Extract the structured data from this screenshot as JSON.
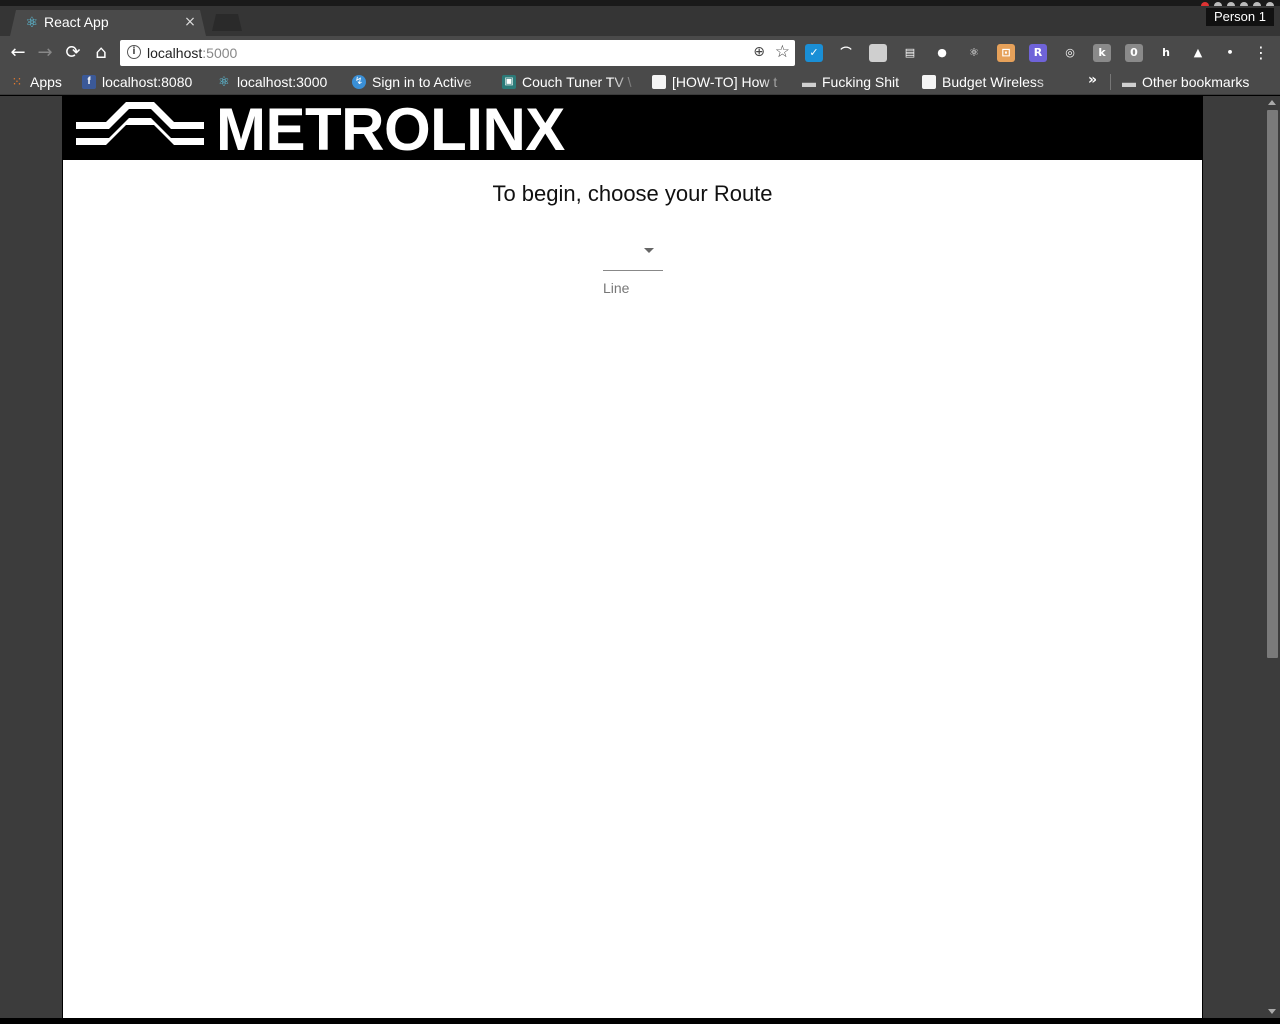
{
  "browser": {
    "tab": {
      "title": "React App",
      "favicon": "react-icon",
      "close": "×"
    },
    "profile": "Person 1",
    "omnibox": {
      "host": "localhost",
      "port": ":5000"
    },
    "nav": {
      "back": "←",
      "forward": "→",
      "reload": "⟳",
      "home": "⌂",
      "menu": "⋮"
    },
    "extensions": [
      {
        "name": "check-extension-icon",
        "glyph": "✓",
        "color": "#1a8fd6"
      },
      {
        "name": "rainbow-extension-icon",
        "glyph": "⌒",
        "color": "#4a4a4a"
      },
      {
        "name": "file-extension-icon",
        "glyph": "",
        "color": "#cfcfcf"
      },
      {
        "name": "chat-extension-icon",
        "glyph": "▤",
        "color": "#4a4a4a"
      },
      {
        "name": "circle-extension-icon",
        "glyph": "●",
        "color": "#4a4a4a"
      },
      {
        "name": "react-devtools-icon",
        "glyph": "⚛",
        "color": "#4a4a4a"
      },
      {
        "name": "outlet-extension-icon",
        "glyph": "⊡",
        "color": "#e6a15a"
      },
      {
        "name": "shield-extension-icon",
        "glyph": "R",
        "color": "#6f63d9"
      },
      {
        "name": "target-extension-icon",
        "glyph": "◎",
        "color": "#4a4a4a"
      },
      {
        "name": "k-extension-icon",
        "glyph": "k",
        "color": "#8a8a8a"
      },
      {
        "name": "box-extension-icon",
        "glyph": "0",
        "color": "#8a8a8a"
      },
      {
        "name": "h-extension-icon",
        "glyph": "h",
        "color": "#4a4a4a"
      },
      {
        "name": "fox-extension-icon",
        "glyph": "▲",
        "color": "#4a4a4a"
      },
      {
        "name": "dot-extension-icon",
        "glyph": "•",
        "color": "#4a4a4a"
      }
    ]
  },
  "bookmarks": {
    "items": [
      {
        "label": "Apps",
        "icon": "apps-grid-icon"
      },
      {
        "label": "localhost:8080",
        "icon": "facebook-icon"
      },
      {
        "label": "localhost:3000",
        "icon": "react-icon"
      },
      {
        "label": "Sign in to Active",
        "icon": "globe-icon"
      },
      {
        "label": "Couch Tuner TV \\",
        "icon": "tv-icon"
      },
      {
        "label": "[HOW-TO] How t",
        "icon": "page-icon"
      },
      {
        "label": "Fucking Shit",
        "icon": "folder-icon"
      },
      {
        "label": "Budget Wireless",
        "icon": "page-icon"
      }
    ],
    "overflow": "»",
    "other": "Other bookmarks"
  },
  "app": {
    "logo_text": "METROLINX",
    "heading": "To begin, choose your Route",
    "line_select": {
      "value": "",
      "helper": "Line"
    }
  },
  "colors": {
    "header_bg": "#000000",
    "page_bg": "#ffffff",
    "chrome_bg": "#4a4a4a"
  }
}
